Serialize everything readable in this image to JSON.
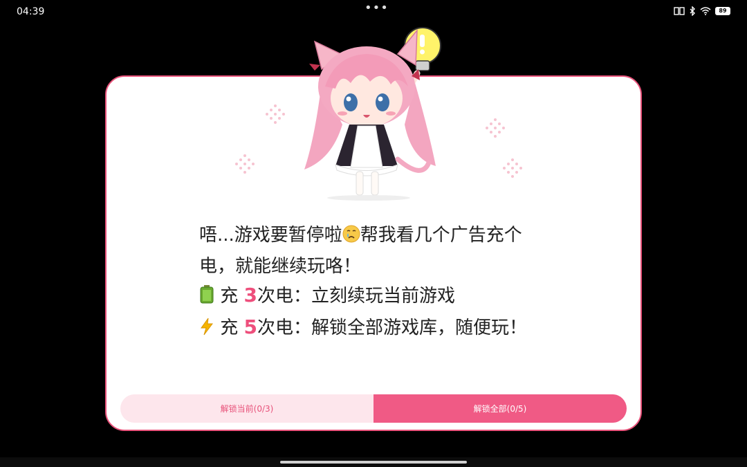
{
  "status_bar": {
    "time": "04:39",
    "battery": "89",
    "icons": [
      "reading-mode-icon",
      "bluetooth-icon",
      "wifi-icon",
      "battery-icon"
    ]
  },
  "dialog": {
    "lines": {
      "line1_a": "唔...游戏要暂停啦",
      "line1_emoji": "crying-face-icon",
      "line1_b": "帮我看几个广告充个",
      "line2": "电，就能继续玩咯！",
      "line3_icon": "battery-emoji-icon",
      "line3_pre": "充",
      "line3_num": "3",
      "line3_post": "次电：立刻续玩当前游戏",
      "line4_icon": "lightning-emoji-icon",
      "line4_pre": "充",
      "line4_num": "5",
      "line4_post": "次电：解锁全部游戏库，随便玩！"
    },
    "buttons": {
      "unlock_current": "解锁当前(0/3)",
      "unlock_all": "解锁全部(0/5)"
    }
  },
  "colors": {
    "accent": "#f05a85",
    "accent_light": "#fde6ec",
    "border": "#e8527a"
  }
}
